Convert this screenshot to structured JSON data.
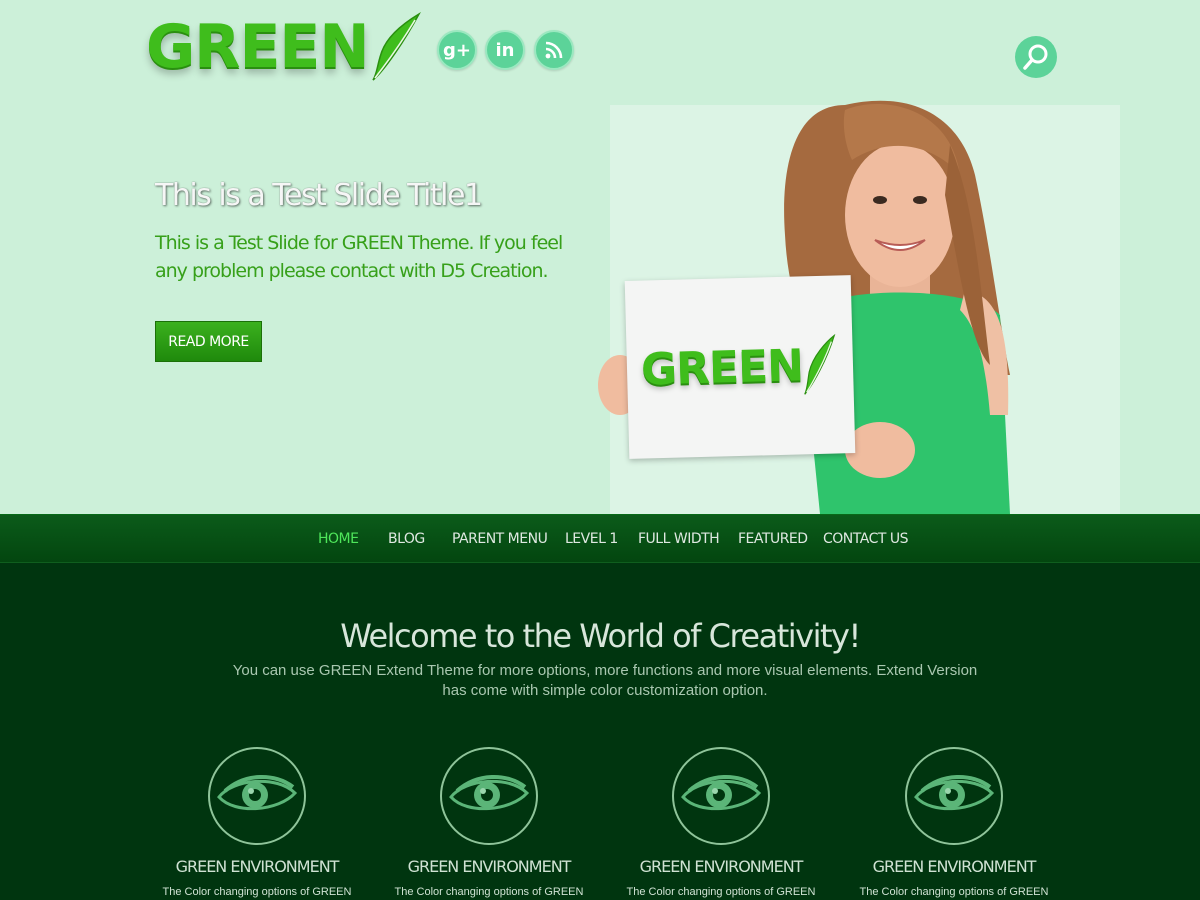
{
  "header": {
    "logo_text": "GREEN",
    "social": [
      {
        "name": "google-plus",
        "glyph": "g+"
      },
      {
        "name": "linkedin",
        "glyph": "in"
      },
      {
        "name": "rss",
        "glyph": ""
      }
    ],
    "search_icon": "magnifier-icon"
  },
  "slide": {
    "title": "This is a Test Slide Title1",
    "description": "This is a Test Slide for GREEN Theme. If you feel any problem please contact with D5 Creation.",
    "button_label": "READ MORE",
    "card_text": "GREEN"
  },
  "nav": {
    "items": [
      {
        "label": "HOME",
        "active": true
      },
      {
        "label": "BLOG"
      },
      {
        "label": "PARENT MENU"
      },
      {
        "label": "LEVEL 1"
      },
      {
        "label": "FULL WIDTH"
      },
      {
        "label": "FEATURED"
      },
      {
        "label": "CONTACT US"
      }
    ]
  },
  "welcome": {
    "title": "Welcome to the World of Creativity!",
    "text": "You can use GREEN Extend Theme for more options, more functions and more visual elements. Extend Version has come with simple color customization option."
  },
  "features": [
    {
      "icon": "eye-icon",
      "title": "GREEN ENVIRONMENT",
      "text": "The Color changing options of GREEN"
    },
    {
      "icon": "eye-icon",
      "title": "GREEN ENVIRONMENT",
      "text": "The Color changing options of GREEN"
    },
    {
      "icon": "eye-icon",
      "title": "GREEN ENVIRONMENT",
      "text": "The Color changing options of GREEN"
    },
    {
      "icon": "eye-icon",
      "title": "GREEN ENVIRONMENT",
      "text": "The Color changing options of GREEN"
    }
  ],
  "colors": {
    "hero_bg": "#ccf0d9",
    "brand_green": "#3fbd1c",
    "nav_bg": "#0b5b1a",
    "nav_active": "#4ee65a",
    "content_bg": "#00350f",
    "social_bg": "#5cd399"
  }
}
